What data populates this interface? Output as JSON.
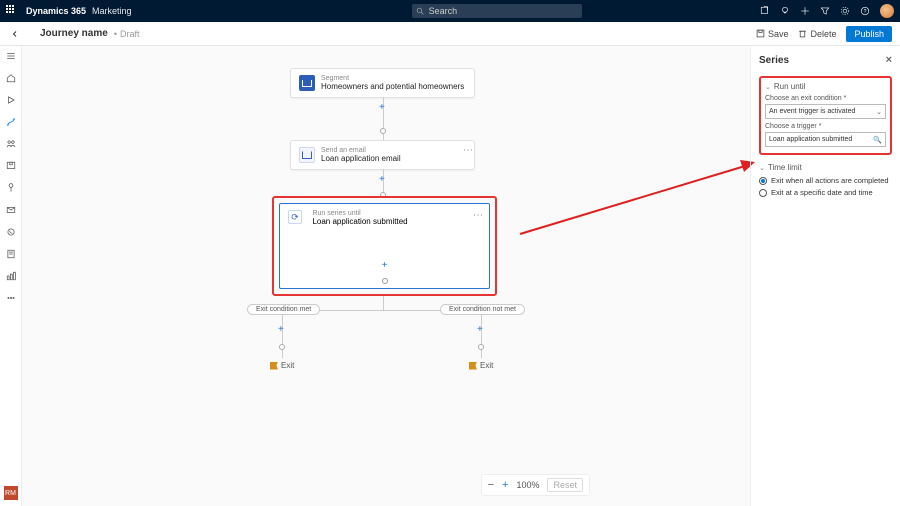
{
  "topbar": {
    "brand": "Dynamics 365",
    "area": "Marketing",
    "search_placeholder": "Search"
  },
  "cmd": {
    "title": "Journey name",
    "status": "Draft",
    "save": "Save",
    "delete": "Delete",
    "publish": "Publish"
  },
  "canvas": {
    "segment": {
      "sup": "Segment",
      "name": "Homeowners and potential homeowners"
    },
    "email": {
      "sup": "Send an email",
      "name": "Loan application email"
    },
    "series": {
      "sup": "Run series until",
      "name": "Loan application submitted"
    },
    "branch_left": "Exit condition met",
    "branch_right": "Exit condition not met",
    "exit": "Exit",
    "zoom_pct": "100%",
    "reset": "Reset"
  },
  "panel": {
    "title": "Series",
    "run_until": "Run until",
    "exit_cond_label": "Choose an exit condition *",
    "exit_cond_value": "An event trigger is activated",
    "trigger_label": "Choose a trigger *",
    "trigger_value": "Loan application submitted",
    "time_limit": "Time limit",
    "radio1": "Exit when all actions are completed",
    "radio2": "Exit at a specific date and time"
  },
  "rm": "RM"
}
